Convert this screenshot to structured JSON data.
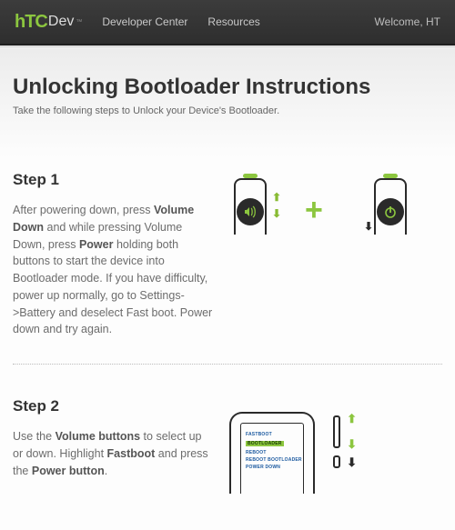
{
  "header": {
    "logo_brand": "hTC",
    "logo_sub": "Dev",
    "logo_tm": "™",
    "nav": {
      "dev_center": "Developer Center",
      "resources": "Resources"
    },
    "welcome": "Welcome, HT"
  },
  "page": {
    "title": "Unlocking Bootloader Instructions",
    "subtitle": "Take the following steps to Unlock your Device's Bootloader."
  },
  "step1": {
    "heading": "Step 1",
    "t1": "After powering down, press ",
    "b1": "Volume Down",
    "t2": " and while pressing Volume Down, press ",
    "b2": "Power",
    "t3": " holding both buttons to start the device into Bootloader mode. If you have difficulty, power up normally, go to Settings->Battery and deselect Fast boot. Power down and try again."
  },
  "step2": {
    "heading": "Step 2",
    "t1": "Use the ",
    "b1": "Volume buttons",
    "t2": " to select up or down. Highlight ",
    "b2": "Fastboot",
    "t3": " and press the ",
    "b3": "Power button",
    "t4": ".",
    "screen": {
      "l1": "FASTBOOT",
      "l2": "BOOTLOADER",
      "l3": "REBOOT",
      "l4": "REBOOT BOOTLOADER",
      "l5": "POWER DOWN"
    }
  }
}
